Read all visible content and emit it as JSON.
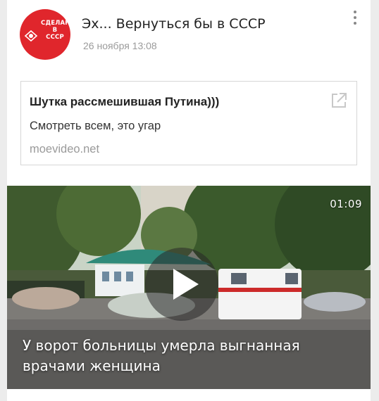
{
  "post": {
    "author": "Эх... Вернуться бы в СССР",
    "date": "26 ноября 13:08",
    "avatar_text": [
      "СДЕЛАН",
      "В",
      "СССР"
    ],
    "menu_icon": "more-vertical-icon"
  },
  "link": {
    "title": "Шутка рассмешившая Путина)))",
    "description": "Смотреть всем, это угар",
    "domain": "moevideo.net",
    "icon": "external-link-icon"
  },
  "video": {
    "duration": "01:09",
    "title": "У ворот больницы умерла выгнанная врачами женщина",
    "play_icon": "play-icon"
  },
  "colors": {
    "brand_red": "#e0262c",
    "secondary_text": "#9b9b9b"
  }
}
